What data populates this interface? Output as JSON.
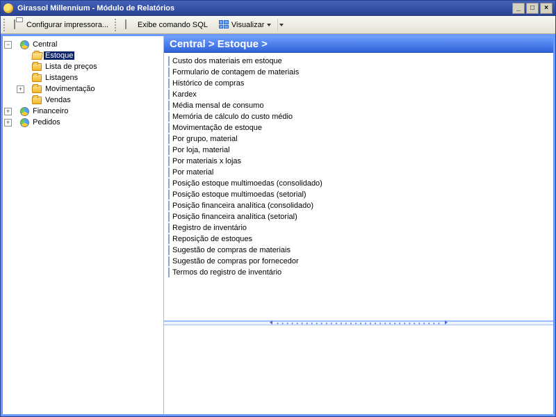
{
  "window": {
    "title": "Girassol Millennium - Módulo de Relatórios"
  },
  "toolbar": {
    "configure_printer": "Configurar impressora...",
    "show_sql": "Exibe comando SQL",
    "visualize": "Visualizar"
  },
  "breadcrumb": "Central > Estoque >",
  "tree": {
    "root": {
      "label": "Central",
      "children": [
        {
          "key": "estoque",
          "label": "Estoque",
          "icon": "folder-open",
          "selected": true
        },
        {
          "key": "lista_precos",
          "label": "Lista de preços",
          "icon": "folder-closed"
        },
        {
          "key": "listagens",
          "label": "Listagens",
          "icon": "folder-closed"
        },
        {
          "key": "movimentacao",
          "label": "Movimentação",
          "icon": "folder-closed",
          "expandable": true
        },
        {
          "key": "vendas",
          "label": "Vendas",
          "icon": "folder-closed"
        }
      ]
    },
    "siblings": [
      {
        "key": "financeiro",
        "label": "Financeiro",
        "icon": "module",
        "expandable": true
      },
      {
        "key": "pedidos",
        "label": "Pedidos",
        "icon": "module",
        "expandable": true
      }
    ]
  },
  "reports": [
    "Custo dos materiais em estoque",
    "Formulario de contagem de materiais",
    "Histórico de compras",
    "Kardex",
    "Média mensal de consumo",
    "Memória de cálculo do custo médio",
    "Movimentação de estoque",
    "Por grupo, material",
    "Por loja, material",
    "Por materiais x lojas",
    "Por material",
    "Posição estoque multimoedas (consolidado)",
    "Posição estoque multimoedas (setorial)",
    "Posição financeira analítica (consolidado)",
    "Posição financeira analítica (setorial)",
    "Registro de inventário",
    "Reposição de estoques",
    "Sugestão de compras de materiais",
    "Sugestão de compras por fornecedor",
    "Termos do registro de inventário"
  ]
}
